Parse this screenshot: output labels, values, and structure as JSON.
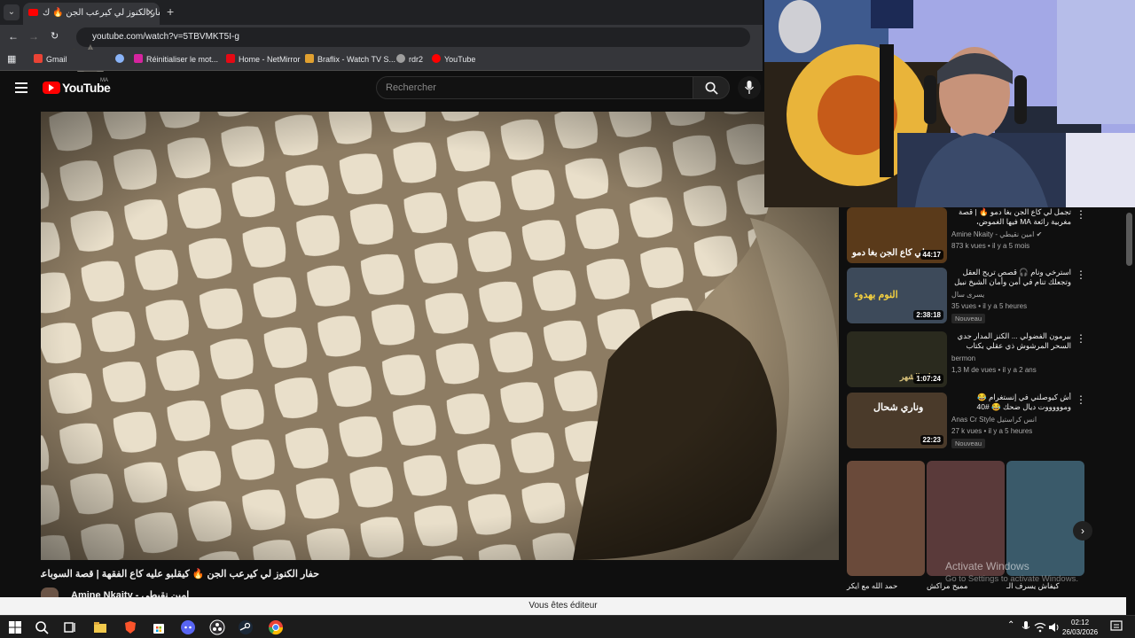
{
  "browser": {
    "tab_title": "حفار الكنوز لي كيرعب الجن 🔥 ك...",
    "new_tab": "+",
    "url": "youtube.com/watch?v=5TBVMKT5I-g",
    "bookmarks": [
      {
        "label": "Gmail",
        "color": "#ea4335"
      },
      {
        "label": "",
        "color": "#8ab4f8"
      },
      {
        "label": "Réinitialiser le mot...",
        "color": "#d6249f"
      },
      {
        "label": "Home - NetMirror",
        "color": "#e50914"
      },
      {
        "label": "Braflix - Watch TV S...",
        "color": "#e0a030"
      },
      {
        "label": "rdr2",
        "color": "#9e9e9e"
      },
      {
        "label": "YouTube",
        "color": "#ff0000"
      }
    ]
  },
  "youtube": {
    "logo_text": "YouTube",
    "region": "MA",
    "search_placeholder": "Rechercher"
  },
  "video": {
    "title": "حفار الكنوز لي كيرعب الجن 🔥 كيقلبو عليه كاع الفقهة | قصة السوباعي",
    "channel": "Amine Nkaity - امين نقيطي"
  },
  "recommendations": [
    {
      "title": "تجمل لي كاع الجن بغا دمو 🔥 | قصة مغربية رائعة MA فيها الغموض، التشويق، الإثارة",
      "channel": "Amine Nkaity - امين نقيطي ✔",
      "meta": "873 k vues • il y a 5 mois",
      "badge": "",
      "duration": "44:17",
      "thumb_color": "#5a3a1a",
      "thumb_text": "لي كاع الجن بغا دمو"
    },
    {
      "title": "استرخي ونام 🎧 قصص تريح العقل وتجعلك تنام في أمن وأمان الشيخ نبيل",
      "channel": "يسرى سال",
      "meta": "35 vues • il y a 5 heures",
      "badge": "Nouveau",
      "duration": "2:38:18",
      "thumb_color": "#3d4a5a",
      "thumb_text": "النوم بهدوء"
    },
    {
      "title": "بيرمون الفضولي ... الكنز المدار جدي السحر المرشوش ذي عقلي بكتاب السحر",
      "channel": "bermon",
      "meta": "1,3 M de vues • il y a 2 ans",
      "badge": "",
      "duration": "1:07:24",
      "thumb_color": "#2a2a1e",
      "thumb_text": "ابو الشهر"
    },
    {
      "title": "أش كيوصلني في إنستغرام 😂 وموووووت ديال ضحك 😂 #40",
      "channel": "Anas Cr Style انس كراستيل",
      "meta": "27 k vues • il y a 5 heures",
      "badge": "Nouveau",
      "duration": "22:23",
      "thumb_color": "#4a3a2a",
      "thumb_text": "وناري شحال"
    }
  ],
  "shorts": [
    {
      "title": "حمد الله مع ايكر",
      "color": "#6a4a3a"
    },
    {
      "title": "مميح مراكش",
      "color": "#5a3a3a"
    },
    {
      "title": "كيفاش يسرف الـ",
      "color": "#3a5a6a"
    }
  ],
  "shorts_next": "›",
  "windows_watermark": {
    "line1": "Activate Windows",
    "line2": "Go to Settings to activate Windows."
  },
  "editor_bar": "Vous êtes éditeur",
  "taskbar": {
    "time": "02:12",
    "date": "26/03/2026"
  }
}
